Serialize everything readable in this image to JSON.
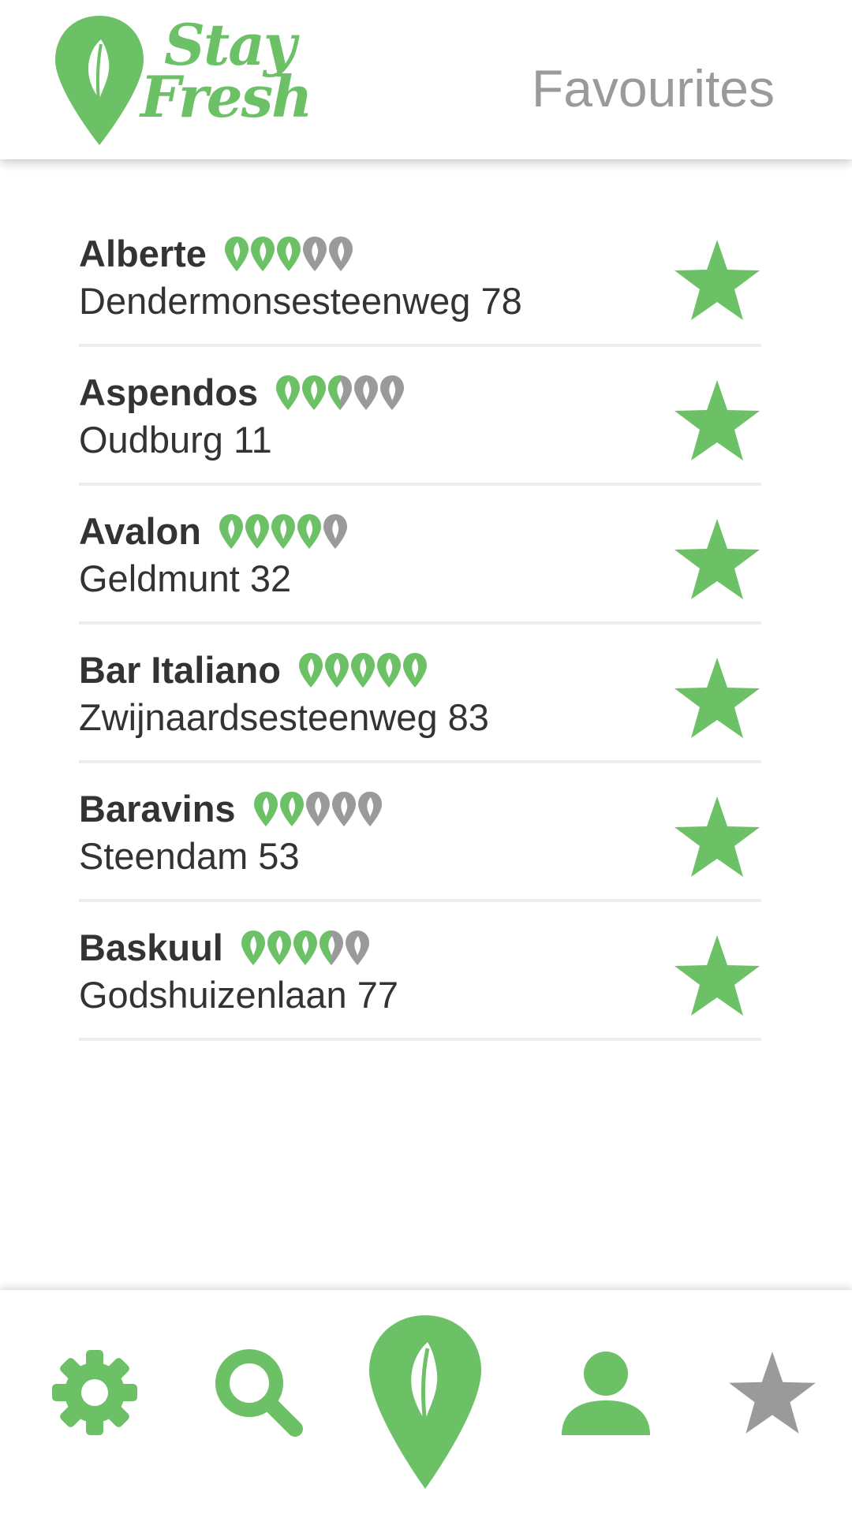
{
  "app": {
    "logo_line1": "Stay",
    "logo_line2": "Fresh"
  },
  "header": {
    "title": "Favourites"
  },
  "colors": {
    "accent": "#6cc166",
    "inactive": "#9a9a9a",
    "text": "#333333",
    "divider": "#eeeeee"
  },
  "favourites": [
    {
      "name": "Alberte",
      "address": "Dendermonsesteenweg 78",
      "rating": 3
    },
    {
      "name": "Aspendos",
      "address": "Oudburg 11",
      "rating": 2.5
    },
    {
      "name": "Avalon",
      "address": "Geldmunt 32",
      "rating": 4
    },
    {
      "name": "Bar Italiano",
      "address": "Zwijnaardsesteenweg 83",
      "rating": 5
    },
    {
      "name": "Baravins",
      "address": "Steendam 53",
      "rating": 2
    },
    {
      "name": "Baskuul",
      "address": "Godshuizenlaan 77",
      "rating": 3.5
    }
  ],
  "nav": {
    "items": [
      {
        "icon": "gear-icon",
        "active": false
      },
      {
        "icon": "search-icon",
        "active": false
      },
      {
        "icon": "map-pin-leaf-icon",
        "active": false
      },
      {
        "icon": "user-icon",
        "active": false
      },
      {
        "icon": "star-icon",
        "active": true
      }
    ]
  }
}
